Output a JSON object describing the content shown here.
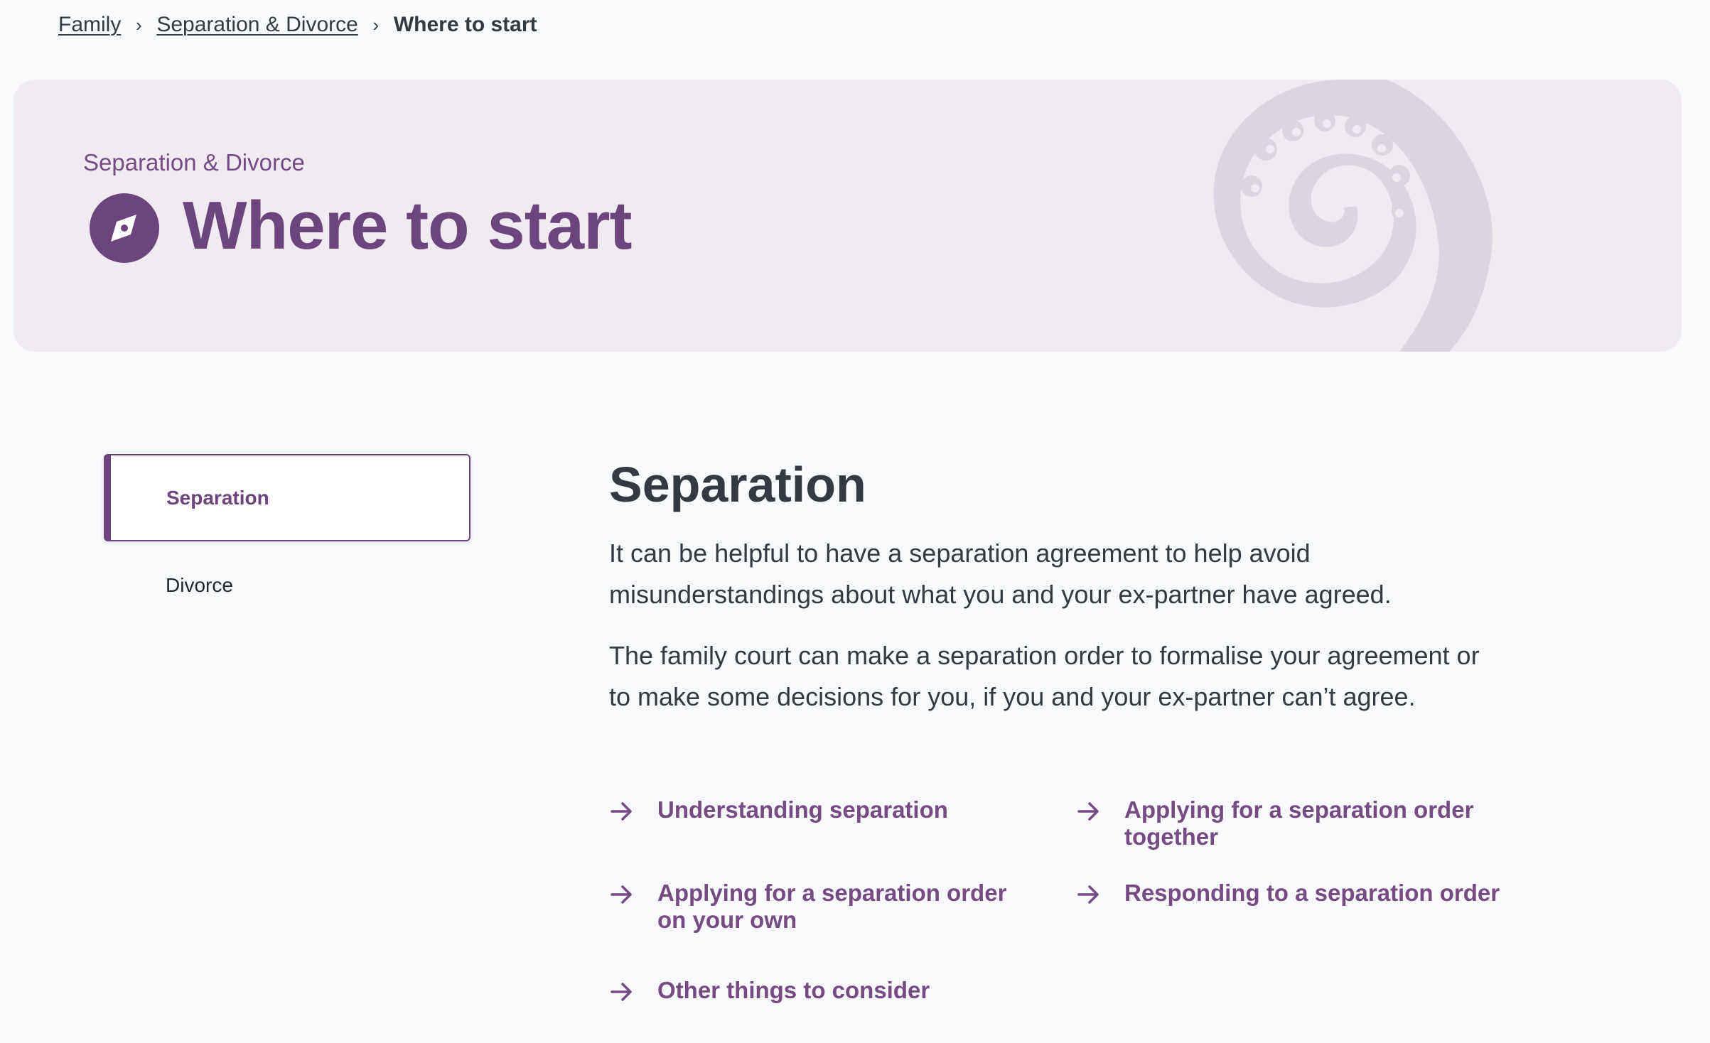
{
  "breadcrumb": {
    "items": [
      {
        "label": "Family"
      },
      {
        "label": "Separation & Divorce"
      }
    ],
    "current": "Where to start",
    "separator": "›"
  },
  "hero": {
    "overline": "Separation & Divorce",
    "title": "Where to start",
    "icon": "compass-icon",
    "background_graphic": "koru-swirl-graphic"
  },
  "sidenav": {
    "items": [
      {
        "label": "Separation",
        "active": true
      },
      {
        "label": "Divorce",
        "active": false
      }
    ]
  },
  "content": {
    "heading": "Separation",
    "paragraphs": [
      "It can be helpful to have a separation agreement to help avoid misunderstandings about what you and your ex-partner have agreed.",
      "The family court can make a separation order to formalise your agreement or to make some decisions for you, if you and your ex-partner can’t agree."
    ],
    "links": [
      {
        "label": "Understanding separation"
      },
      {
        "label": "Applying for a separation order together"
      },
      {
        "label": "Applying for a separation order on your own"
      },
      {
        "label": "Responding to a separation order"
      },
      {
        "label": "Other things to consider"
      }
    ],
    "link_icon": "arrow-right-icon"
  },
  "colors": {
    "accent": "#6c447e",
    "hero_background": "#f0ebf1",
    "page_background": "#f7f9fb",
    "text": "#333a42"
  }
}
